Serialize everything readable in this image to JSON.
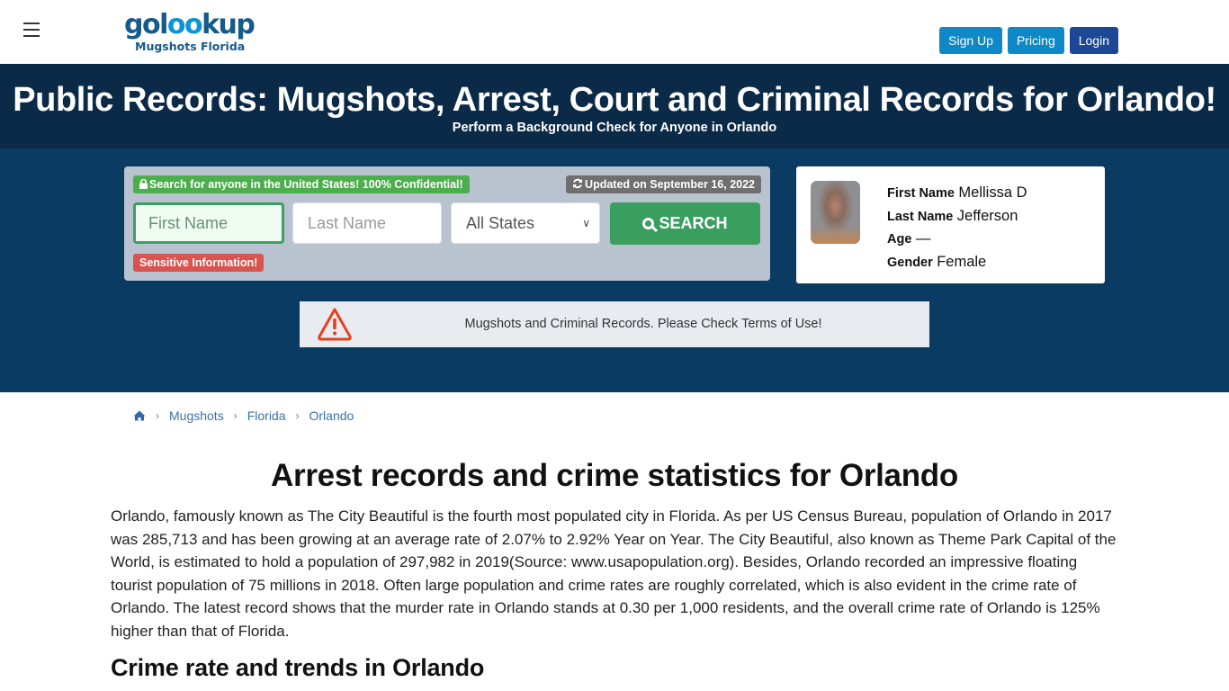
{
  "header": {
    "logo": {
      "brand_prefix": "gol",
      "brand_oo": "oo",
      "brand_suffix": "kup",
      "subtitle": "Mugshots Florida"
    },
    "buttons": [
      {
        "label": "Sign Up",
        "color": "#0e88c6"
      },
      {
        "label": "Pricing",
        "color": "#0e88c6"
      },
      {
        "label": "Login",
        "color": "#1c4896"
      }
    ]
  },
  "hero": {
    "title": "Public Records: Mugshots, Arrest, Court and Criminal Records for Orlando!",
    "subtitle": "Perform a Background Check for Anyone in Orlando"
  },
  "search": {
    "confidential_badge": "Search for anyone in the United States! 100% Confidential!",
    "updated_badge": "Updated on September 16, 2022",
    "first_name_placeholder": "First Name",
    "last_name_placeholder": "Last Name",
    "state_selected": "All States",
    "search_button": "SEARCH",
    "sensitive_badge": "Sensitive Information!"
  },
  "profile": {
    "rows": [
      {
        "key": "First Name",
        "value": "Mellissa D"
      },
      {
        "key": "Last Name",
        "value": "Jefferson"
      },
      {
        "key": "Age",
        "value": "—"
      },
      {
        "key": "Gender",
        "value": "Female"
      }
    ]
  },
  "notice": {
    "icon": "warning-triangle-icon",
    "text": "Mugshots and Criminal Records. Please Check Terms of Use!"
  },
  "breadcrumb": {
    "home_icon": "home-icon",
    "items": [
      "Mugshots",
      "Florida",
      "Orlando"
    ]
  },
  "content": {
    "title": "Arrest records and crime statistics for Orlando",
    "paragraph": "Orlando, famously known as The City Beautiful is the fourth most populated city in Florida. As per US Census Bureau, population of Orlando in 2017 was 285,713 and has been growing at an average rate of 2.07% to 2.92% Year on Year. The City Beautiful, also known as Theme Park Capital of the World, is estimated to hold a population of 297,982 in 2019(Source: www.usapopulation.org). Besides, Orlando recorded an impressive floating tourist population of 75 millions in 2018. Often large population and crime rates are roughly correlated, which is also evident in the crime rate of Orlando. The latest record shows that the murder rate in Orlando stands at 0.30 per 1,000 residents, and the overall crime rate of Orlando is 125% higher than that of Florida.",
    "section_heading": "Crime rate and trends in Orlando"
  }
}
